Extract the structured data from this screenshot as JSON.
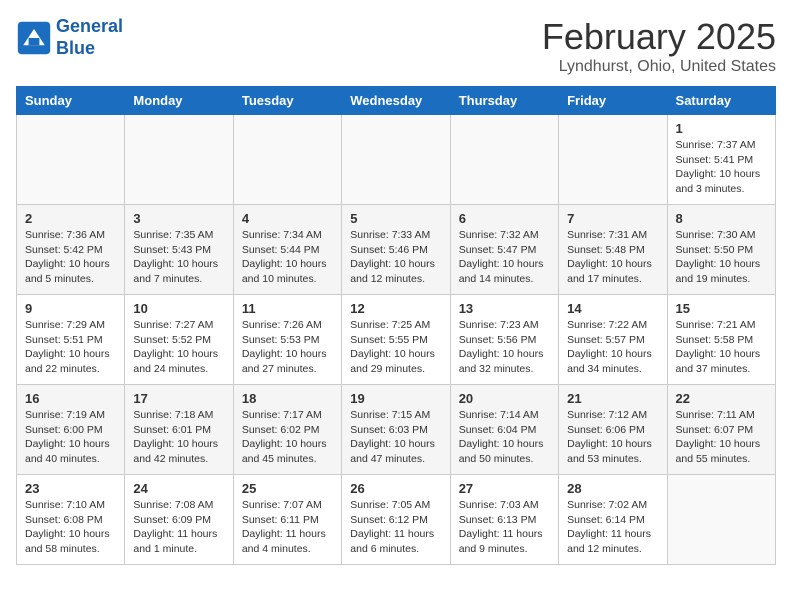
{
  "header": {
    "logo_line1": "General",
    "logo_line2": "Blue",
    "month": "February 2025",
    "location": "Lyndhurst, Ohio, United States"
  },
  "weekdays": [
    "Sunday",
    "Monday",
    "Tuesday",
    "Wednesday",
    "Thursday",
    "Friday",
    "Saturday"
  ],
  "weeks": [
    [
      {
        "day": "",
        "info": ""
      },
      {
        "day": "",
        "info": ""
      },
      {
        "day": "",
        "info": ""
      },
      {
        "day": "",
        "info": ""
      },
      {
        "day": "",
        "info": ""
      },
      {
        "day": "",
        "info": ""
      },
      {
        "day": "1",
        "info": "Sunrise: 7:37 AM\nSunset: 5:41 PM\nDaylight: 10 hours\nand 3 minutes."
      }
    ],
    [
      {
        "day": "2",
        "info": "Sunrise: 7:36 AM\nSunset: 5:42 PM\nDaylight: 10 hours\nand 5 minutes."
      },
      {
        "day": "3",
        "info": "Sunrise: 7:35 AM\nSunset: 5:43 PM\nDaylight: 10 hours\nand 7 minutes."
      },
      {
        "day": "4",
        "info": "Sunrise: 7:34 AM\nSunset: 5:44 PM\nDaylight: 10 hours\nand 10 minutes."
      },
      {
        "day": "5",
        "info": "Sunrise: 7:33 AM\nSunset: 5:46 PM\nDaylight: 10 hours\nand 12 minutes."
      },
      {
        "day": "6",
        "info": "Sunrise: 7:32 AM\nSunset: 5:47 PM\nDaylight: 10 hours\nand 14 minutes."
      },
      {
        "day": "7",
        "info": "Sunrise: 7:31 AM\nSunset: 5:48 PM\nDaylight: 10 hours\nand 17 minutes."
      },
      {
        "day": "8",
        "info": "Sunrise: 7:30 AM\nSunset: 5:50 PM\nDaylight: 10 hours\nand 19 minutes."
      }
    ],
    [
      {
        "day": "9",
        "info": "Sunrise: 7:29 AM\nSunset: 5:51 PM\nDaylight: 10 hours\nand 22 minutes."
      },
      {
        "day": "10",
        "info": "Sunrise: 7:27 AM\nSunset: 5:52 PM\nDaylight: 10 hours\nand 24 minutes."
      },
      {
        "day": "11",
        "info": "Sunrise: 7:26 AM\nSunset: 5:53 PM\nDaylight: 10 hours\nand 27 minutes."
      },
      {
        "day": "12",
        "info": "Sunrise: 7:25 AM\nSunset: 5:55 PM\nDaylight: 10 hours\nand 29 minutes."
      },
      {
        "day": "13",
        "info": "Sunrise: 7:23 AM\nSunset: 5:56 PM\nDaylight: 10 hours\nand 32 minutes."
      },
      {
        "day": "14",
        "info": "Sunrise: 7:22 AM\nSunset: 5:57 PM\nDaylight: 10 hours\nand 34 minutes."
      },
      {
        "day": "15",
        "info": "Sunrise: 7:21 AM\nSunset: 5:58 PM\nDaylight: 10 hours\nand 37 minutes."
      }
    ],
    [
      {
        "day": "16",
        "info": "Sunrise: 7:19 AM\nSunset: 6:00 PM\nDaylight: 10 hours\nand 40 minutes."
      },
      {
        "day": "17",
        "info": "Sunrise: 7:18 AM\nSunset: 6:01 PM\nDaylight: 10 hours\nand 42 minutes."
      },
      {
        "day": "18",
        "info": "Sunrise: 7:17 AM\nSunset: 6:02 PM\nDaylight: 10 hours\nand 45 minutes."
      },
      {
        "day": "19",
        "info": "Sunrise: 7:15 AM\nSunset: 6:03 PM\nDaylight: 10 hours\nand 47 minutes."
      },
      {
        "day": "20",
        "info": "Sunrise: 7:14 AM\nSunset: 6:04 PM\nDaylight: 10 hours\nand 50 minutes."
      },
      {
        "day": "21",
        "info": "Sunrise: 7:12 AM\nSunset: 6:06 PM\nDaylight: 10 hours\nand 53 minutes."
      },
      {
        "day": "22",
        "info": "Sunrise: 7:11 AM\nSunset: 6:07 PM\nDaylight: 10 hours\nand 55 minutes."
      }
    ],
    [
      {
        "day": "23",
        "info": "Sunrise: 7:10 AM\nSunset: 6:08 PM\nDaylight: 10 hours\nand 58 minutes."
      },
      {
        "day": "24",
        "info": "Sunrise: 7:08 AM\nSunset: 6:09 PM\nDaylight: 11 hours\nand 1 minute."
      },
      {
        "day": "25",
        "info": "Sunrise: 7:07 AM\nSunset: 6:11 PM\nDaylight: 11 hours\nand 4 minutes."
      },
      {
        "day": "26",
        "info": "Sunrise: 7:05 AM\nSunset: 6:12 PM\nDaylight: 11 hours\nand 6 minutes."
      },
      {
        "day": "27",
        "info": "Sunrise: 7:03 AM\nSunset: 6:13 PM\nDaylight: 11 hours\nand 9 minutes."
      },
      {
        "day": "28",
        "info": "Sunrise: 7:02 AM\nSunset: 6:14 PM\nDaylight: 11 hours\nand 12 minutes."
      },
      {
        "day": "",
        "info": ""
      }
    ]
  ]
}
